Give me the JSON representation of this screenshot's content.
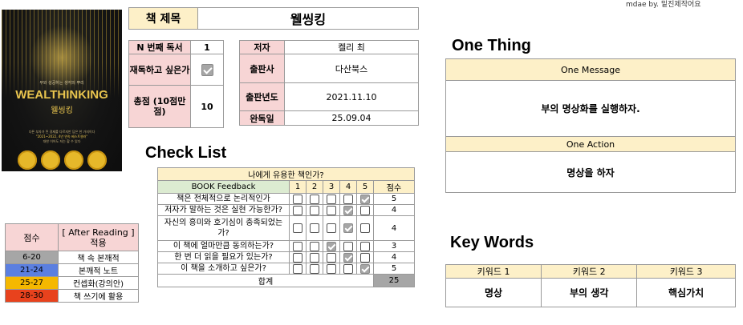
{
  "credit": "mdae by. 밑진제작어요",
  "cover": {
    "en_title": "WEALTHINKING",
    "ko_title": "웰씽킹",
    "top_line": "부와 성공하는 생각의 뿌리",
    "desc_lines": [
      "다른 부자가 된 경제를 다르지만 답은 한 가지이다",
      "\"2021~2022, 4년 연속 베스트셀러\"",
      "대한 이어도 저는 할 수 있다"
    ]
  },
  "book": {
    "title_label": "책 제목",
    "title_value": "웰씽킹",
    "nth_label": "N 번째 독서",
    "nth_value": "1",
    "reread_label": "재독하고 싶은가",
    "reread_checked": true,
    "score_label": "총점 (10점만점)",
    "score_value": "10",
    "author_label": "저자",
    "author_value": "켈리 최",
    "publisher_label": "출판사",
    "publisher_value": "다산북스",
    "year_label": "출판년도",
    "year_value": "2021.11.10",
    "done_label": "완독일",
    "done_value": "25.09.04"
  },
  "checklist": {
    "heading": "Check List",
    "question": "나에게 유용한 책인가?",
    "col_feedback": "BOOK Feedback",
    "cols": [
      "1",
      "2",
      "3",
      "4",
      "5"
    ],
    "col_score": "점수",
    "rows": [
      {
        "q": "책은 전체적으로 논리적인가",
        "checked": 5,
        "score": "5"
      },
      {
        "q": "저자가 말하는 것은 실현 가능한가?",
        "checked": 4,
        "score": "4"
      },
      {
        "q": "자신의 흥미와 호기심이 충족되었는가?",
        "checked": 4,
        "score": "4"
      },
      {
        "q": "이 책에 얼마만큼 동의하는가?",
        "checked": 3,
        "score": "3"
      },
      {
        "q": "한 번 더 읽을 필요가 있는가?",
        "checked": 4,
        "score": "4"
      },
      {
        "q": "이 책을 소개하고 싶은가?",
        "checked": 5,
        "score": "5"
      }
    ],
    "total_label": "합계",
    "total_value": "25"
  },
  "legend": {
    "col_score": "점수",
    "col_apply": "[ After Reading ] 적용",
    "rows": [
      {
        "range": "6-20",
        "text": "책 속 본깨적",
        "color": "#a6a6a6"
      },
      {
        "range": "21-24",
        "text": "본깨적 노트",
        "color": "#5b7fe0"
      },
      {
        "range": "25-27",
        "text": "컨셉화(강의안)",
        "color": "#f5b800"
      },
      {
        "range": "28-30",
        "text": "책 쓰기에 활용",
        "color": "#e8421d"
      }
    ]
  },
  "one_thing": {
    "heading": "One Thing",
    "message_label": "One Message",
    "message_value": "부의 명상화를 실행하자.",
    "action_label": "One Action",
    "action_value": "명상을 하자"
  },
  "key_words": {
    "heading": "Key Words",
    "labels": [
      "키워드 1",
      "키워드 2",
      "키워드 3"
    ],
    "values": [
      "명상",
      "부의 생각",
      "핵심가치"
    ]
  },
  "colors": {
    "header_yellow": "#fdf0c8",
    "header_pink": "#f7d5d5",
    "header_green": "#dcebd1"
  }
}
